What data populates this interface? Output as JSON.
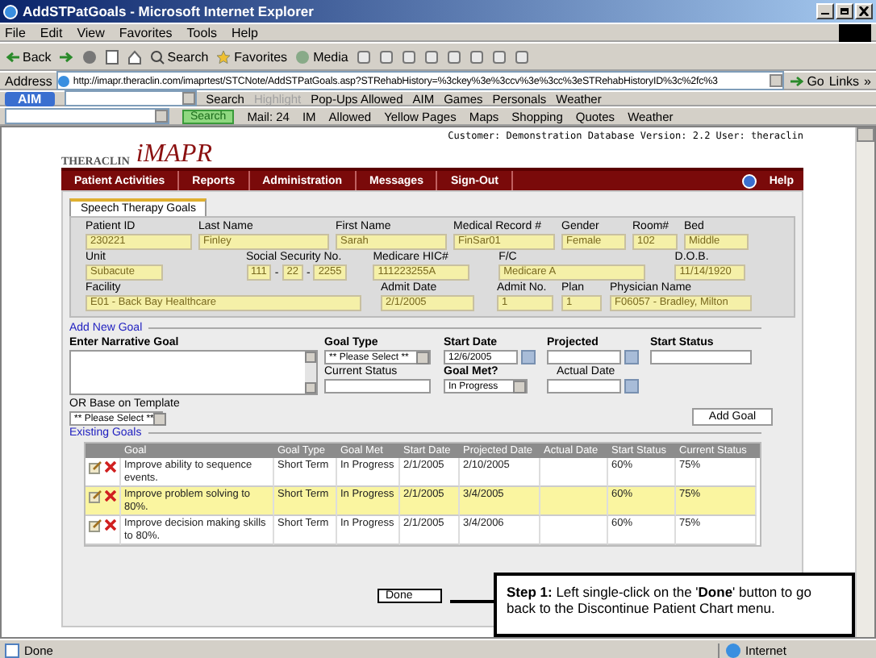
{
  "window": {
    "title": "AddSTPatGoals - Microsoft Internet Explorer"
  },
  "menu": [
    "File",
    "Edit",
    "View",
    "Favorites",
    "Tools",
    "Help"
  ],
  "toolbar": [
    "Back",
    "Search",
    "Favorites",
    "Media"
  ],
  "address": {
    "label": "Address",
    "url": "http://imapr.theraclin.com/imaprtest/STCNote/AddSTPatGoals.asp?STRehabHistory=%3ckey%3e%3ccv%3e%3cc%3eSTRehabHistoryID%3c%2fc%3",
    "go": "Go",
    "links": "Links",
    "more": "»"
  },
  "aim_bar": {
    "logo": "AIM",
    "items": [
      {
        "label": "Search",
        "disabled": false
      },
      {
        "label": "Highlight",
        "disabled": true
      },
      {
        "label": "Pop-Ups Allowed",
        "disabled": false
      },
      {
        "label": "AIM",
        "disabled": false
      },
      {
        "label": "Games",
        "disabled": false
      },
      {
        "label": "Personals",
        "disabled": false
      },
      {
        "label": "Weather",
        "disabled": false
      }
    ]
  },
  "toolbar2": {
    "search": "Search",
    "items": [
      "Mail: 24",
      "IM",
      "Allowed",
      "Yellow Pages",
      "Maps",
      "Shopping",
      "Quotes",
      "Weather"
    ]
  },
  "header": {
    "logo": "THERACLIN",
    "product": "iMAPR",
    "info": "Customer: Demonstration Database Version: 2.2 User: theraclin"
  },
  "nav": [
    "Patient Activities",
    "Reports",
    "Administration",
    "Messages",
    "Sign-Out"
  ],
  "help": "Help",
  "tabs": [
    {
      "label": "Speech Therapy Goals",
      "selected": true
    }
  ],
  "patient": [
    [
      {
        "label": "Patient ID",
        "value": "230221"
      },
      {
        "label": "Last Name",
        "value": "Finley"
      },
      {
        "label": "First Name",
        "value": "Sarah"
      },
      {
        "label": "Medical Record #",
        "value": "FinSar01"
      },
      {
        "label": "Gender",
        "value": "Female"
      },
      {
        "label": "Room#",
        "value": "102"
      },
      {
        "label": "Bed",
        "value": "Middle"
      }
    ],
    [
      {
        "label": "Unit",
        "value": "Subacute"
      },
      {
        "label": "Social Security No.",
        "parts": [
          "111",
          "22",
          "2255"
        ],
        "separator": "-"
      },
      {
        "label": "Medicare HIC#",
        "value": "111223255A"
      },
      {
        "label": "F/C",
        "value": "Medicare A"
      },
      {
        "label": "D.O.B.",
        "value": "11/14/1920"
      }
    ],
    [
      {
        "label": "Facility",
        "value": "E01 - Back Bay Healthcare"
      },
      {
        "label": "Admit Date",
        "value": "2/1/2005"
      },
      {
        "label": "Admit No.",
        "value": "1"
      },
      {
        "label": "Plan",
        "value": "1"
      },
      {
        "label": "Physician Name",
        "value": "F06057 - Bradley, Milton"
      }
    ]
  ],
  "new_goal": {
    "title": "Add New Goal",
    "narrative": {
      "label": "Enter Narrative Goal"
    },
    "goal_type": {
      "label": "Goal Type",
      "value": "** Please Select **"
    },
    "start_date": {
      "label": "Start Date",
      "value": "12/6/2005"
    },
    "projected": {
      "label": "Projected"
    },
    "start_status": {
      "label": "Start Status"
    },
    "current_status": {
      "label": "Current Status"
    },
    "goal_met": {
      "label": "Goal Met?",
      "value": "In Progress"
    },
    "actual_date": {
      "label": "Actual Date"
    },
    "template": {
      "label": "OR Base on Template",
      "value": "** Please Select **"
    },
    "add_button": "Add Goal"
  },
  "existing_goals": {
    "title": "Existing Goals",
    "columns": [
      "Goal",
      "Goal Type",
      "Goal Met",
      "Start Date",
      "Projected Date",
      "Actual Date",
      "Start Status",
      "Current Status"
    ],
    "rows": [
      {
        "goal": "Improve ability to sequence events.",
        "goal_type": "Short Term",
        "goal_met": "In Progress",
        "start_date": "2/1/2005",
        "projected_date": "2/10/2005",
        "start_status": "60%",
        "current_status": "75%",
        "selected": false
      },
      {
        "goal": "Improve problem solving to 80%.",
        "goal_type": "Short Term",
        "goal_met": "In Progress",
        "start_date": "2/1/2005",
        "projected_date": "3/4/2005",
        "start_status": "60%",
        "current_status": "75%",
        "selected": true
      },
      {
        "goal": "Improve decision making skills to 80%.",
        "goal_type": "Short Term",
        "goal_met": "In Progress",
        "start_date": "2/1/2005",
        "projected_date": "3/4/2006",
        "start_status": "60%",
        "current_status": "75%",
        "selected": false
      }
    ]
  },
  "done_button": "Done",
  "callout": "**Step 1:** Left single-click on the '**Done**' button to go back to the Discontinue Patient Chart menu.",
  "status_bar": {
    "text": "Done",
    "zone": "Internet"
  }
}
